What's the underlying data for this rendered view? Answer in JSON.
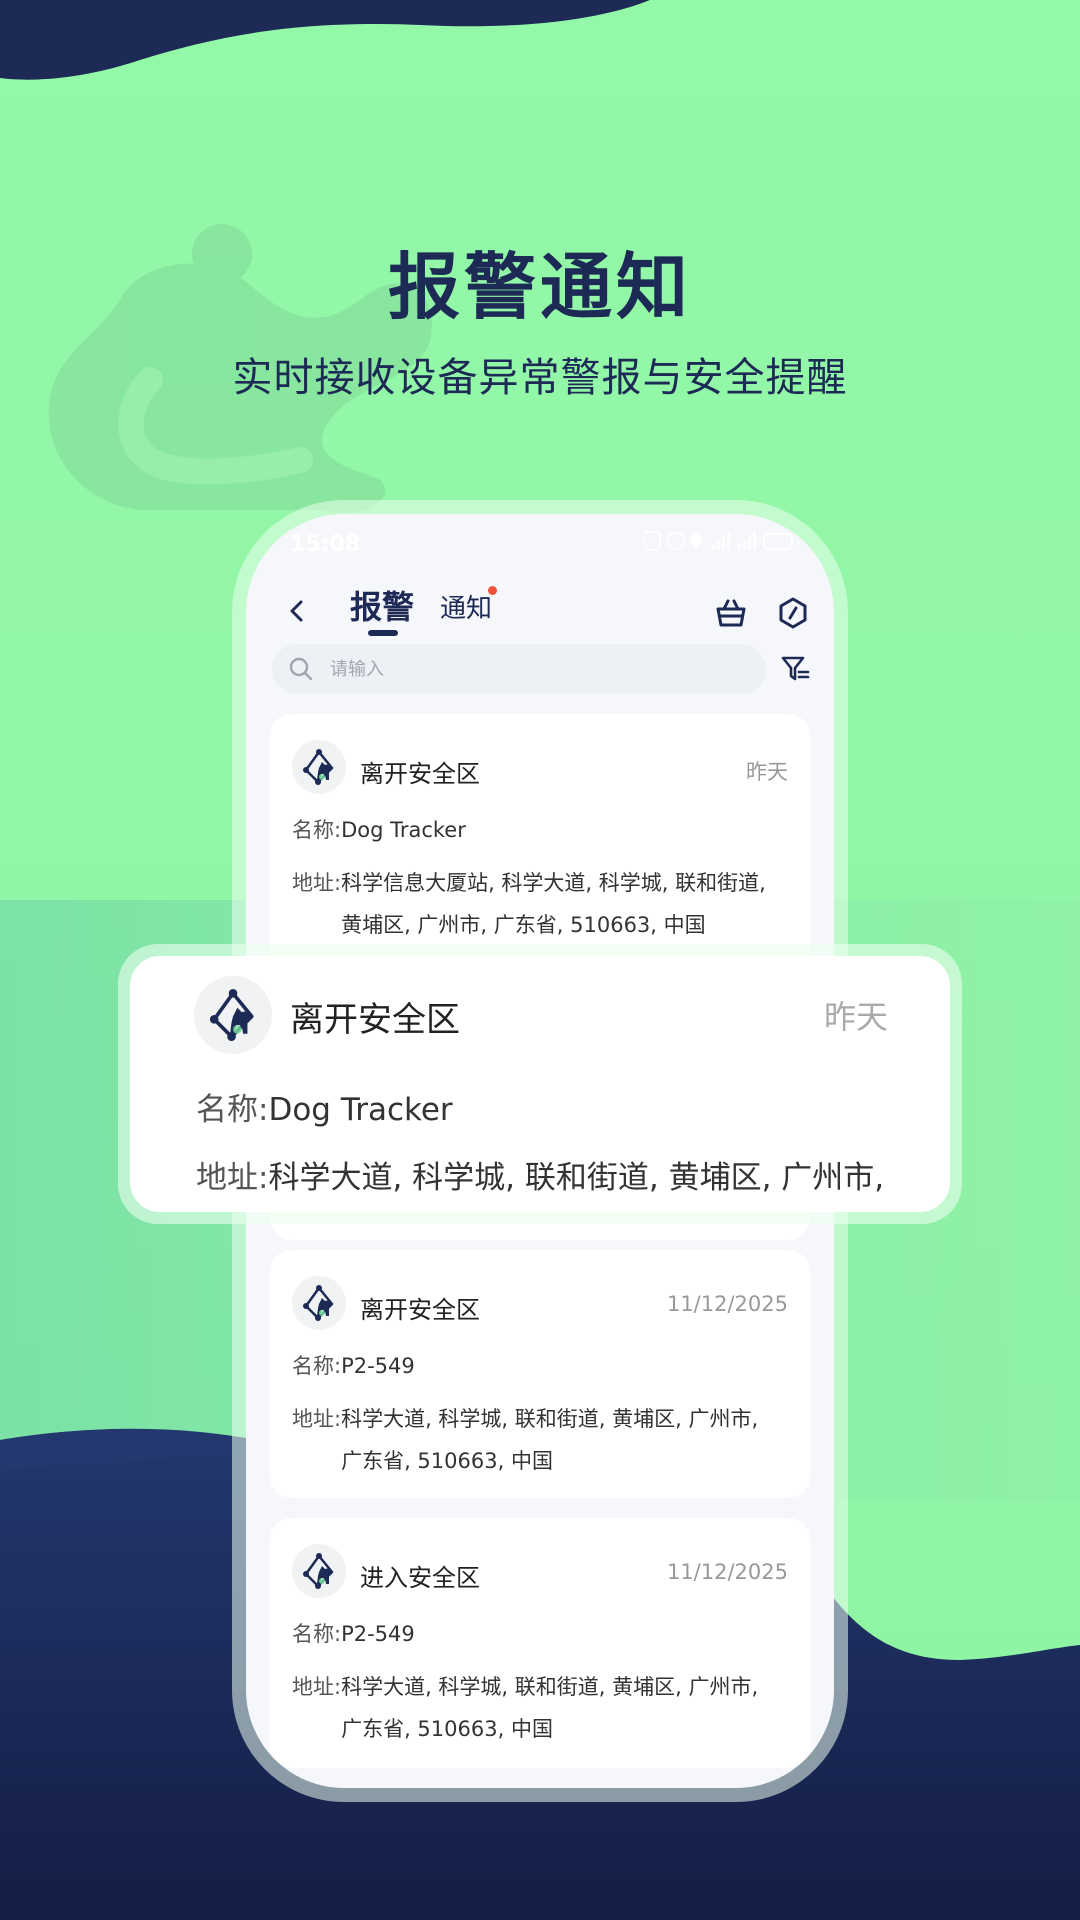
{
  "hero": {
    "title": "报警通知",
    "subtitle": "实时接收设备异常警报与安全提醒"
  },
  "colors": {
    "accent_dark": "#1c2a55",
    "background_green": "#92f7a6",
    "notice_dot": "#f0533a"
  },
  "status_bar": {
    "time": "15:08",
    "icons": [
      "nfc-icon",
      "alarm-icon",
      "location-icon",
      "signal-icon",
      "signal-icon",
      "battery-icon"
    ]
  },
  "nav": {
    "tabs": [
      {
        "label": "报警",
        "active": true
      },
      {
        "label": "通知",
        "active": false,
        "has_dot": true
      }
    ],
    "icons": [
      "back-icon",
      "basket-icon",
      "hexagon-icon"
    ]
  },
  "search": {
    "placeholder": "请输入"
  },
  "labels": {
    "name": "名称:",
    "address": "地址:"
  },
  "cards": [
    {
      "title": "离开安全区",
      "time": "昨天",
      "name": "Dog Tracker",
      "address_line1": "科学信息大厦站, 科学大道, 科学城, 联和街道,",
      "address_line2": "黄埔区, 广州市, 广东省, 510663, 中国"
    },
    {
      "title": "离开安全区",
      "time": "11/12/2025",
      "name": "P2-549",
      "address_line1": "科学大道, 科学城, 联和街道, 黄埔区, 广州市,",
      "address_line2": "广东省, 510663, 中国"
    },
    {
      "title": "进入安全区",
      "time": "11/12/2025",
      "name": "P2-549",
      "address_line1": "科学大道, 科学城, 联和街道, 黄埔区, 广州市,",
      "address_line2": "广东省, 510663, 中国"
    }
  ],
  "popout": {
    "title": "离开安全区",
    "time": "昨天",
    "name": "Dog Tracker",
    "address": "科学大道, 科学城, 联和街道, 黄埔区, 广州市,"
  }
}
